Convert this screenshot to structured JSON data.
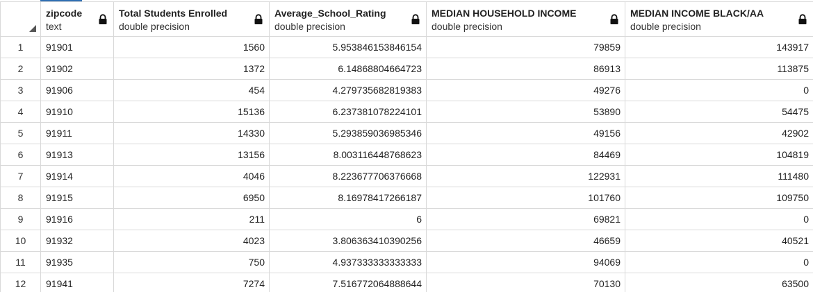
{
  "columns": [
    {
      "name": "zipcode",
      "type": "text"
    },
    {
      "name": "Total Students Enrolled",
      "type": "double precision"
    },
    {
      "name": "Average_School_Rating",
      "type": "double precision"
    },
    {
      "name": "MEDIAN HOUSEHOLD INCOME",
      "type": "double precision"
    },
    {
      "name": "MEDIAN INCOME BLACK/AA",
      "type": "double precision"
    }
  ],
  "rows": [
    {
      "rn": "1",
      "c": [
        "91901",
        "1560",
        "5.953846153846154",
        "79859",
        "143917"
      ]
    },
    {
      "rn": "2",
      "c": [
        "91902",
        "1372",
        "6.14868804664723",
        "86913",
        "113875"
      ]
    },
    {
      "rn": "3",
      "c": [
        "91906",
        "454",
        "4.279735682819383",
        "49276",
        "0"
      ]
    },
    {
      "rn": "4",
      "c": [
        "91910",
        "15136",
        "6.237381078224101",
        "53890",
        "54475"
      ]
    },
    {
      "rn": "5",
      "c": [
        "91911",
        "14330",
        "5.293859036985346",
        "49156",
        "42902"
      ]
    },
    {
      "rn": "6",
      "c": [
        "91913",
        "13156",
        "8.003116448768623",
        "84469",
        "104819"
      ]
    },
    {
      "rn": "7",
      "c": [
        "91914",
        "4046",
        "8.223677706376668",
        "122931",
        "111480"
      ]
    },
    {
      "rn": "8",
      "c": [
        "91915",
        "6950",
        "8.16978417266187",
        "101760",
        "109750"
      ]
    },
    {
      "rn": "9",
      "c": [
        "91916",
        "211",
        "6",
        "69821",
        "0"
      ]
    },
    {
      "rn": "10",
      "c": [
        "91932",
        "4023",
        "3.806363410390256",
        "46659",
        "40521"
      ]
    },
    {
      "rn": "11",
      "c": [
        "91935",
        "750",
        "4.937333333333333",
        "94069",
        "0"
      ]
    },
    {
      "rn": "12",
      "c": [
        "91941",
        "7274",
        "7.516772064888644",
        "70130",
        "63500"
      ]
    }
  ],
  "icons": {
    "lock": "lock-icon",
    "corner": "select-all-triangle-icon"
  }
}
